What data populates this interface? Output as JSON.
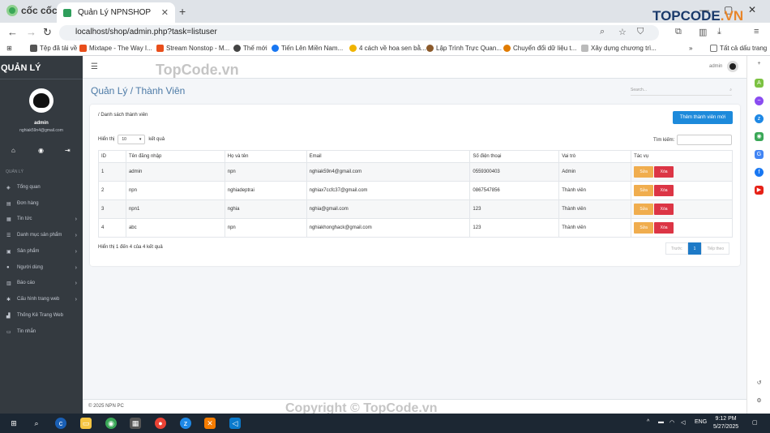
{
  "browser": {
    "brand": "cốc cốc",
    "tab_title": "Quản Lý NPNSHOP",
    "url": "localhost/shop/admin.php?task=listuser",
    "all_bookmarks": "Tất cả dấu trang",
    "bookmarks": [
      {
        "label": "Tệp đã tải về",
        "color": "#555"
      },
      {
        "label": "Mixtape - The Way I...",
        "color": "#e94e1b"
      },
      {
        "label": "Stream Nonstop - M...",
        "color": "#e94e1b"
      },
      {
        "label": "Thế mới",
        "color": "#444"
      },
      {
        "label": "Tiến Lên Miền Nam...",
        "color": "#1877f2"
      },
      {
        "label": "4 cách về hoa sen bằ...",
        "color": "#f0b400"
      },
      {
        "label": "Lập Trình Trực Quan...",
        "color": "#8b5a2b"
      },
      {
        "label": "Chuyển đổi dữ liệu t...",
        "color": "#e07b00"
      },
      {
        "label": "Xây dựng chương trì...",
        "color": "#999"
      }
    ]
  },
  "sidebar": {
    "title": "QUẢN LÝ",
    "username": "admin",
    "email": "nghiak59n4@gmail.com",
    "section": "QUẢN LÝ",
    "items": [
      {
        "label": "Tổng quan",
        "icon": "palette-icon",
        "arrow": false
      },
      {
        "label": "Đơn hàng",
        "icon": "receipt-icon",
        "arrow": false
      },
      {
        "label": "Tin tức",
        "icon": "news-icon",
        "arrow": true
      },
      {
        "label": "Danh mục sản phẩm",
        "icon": "list-icon",
        "arrow": true
      },
      {
        "label": "Sản phẩm",
        "icon": "box-icon",
        "arrow": true
      },
      {
        "label": "Người dùng",
        "icon": "user-icon",
        "arrow": true
      },
      {
        "label": "Báo cáo",
        "icon": "report-icon",
        "arrow": true
      },
      {
        "label": "Cấu hình trang web",
        "icon": "gears-icon",
        "arrow": true
      },
      {
        "label": "Thống Kê Trang Web",
        "icon": "chart-icon",
        "arrow": false
      },
      {
        "label": "Tin nhắn",
        "icon": "message-icon",
        "arrow": false
      }
    ]
  },
  "header": {
    "admin_label": "admin",
    "page_title": "Quản Lý / Thành Viên",
    "search_placeholder": "Search..."
  },
  "content": {
    "breadcrumb": "/ Danh sách thành viên",
    "add_button": "Thêm thành viên mới",
    "length_prefix": "Hiển thị",
    "length_value": "10",
    "length_suffix": "kết quả",
    "search_label": "Tìm kiếm:",
    "columns": [
      "ID",
      "Tên đăng nhập",
      "Họ và tên",
      "Email",
      "Số điện thoại",
      "Vai trò",
      "Tác vụ"
    ],
    "rows": [
      {
        "id": "1",
        "username": "admin",
        "fullname": "npn",
        "email": "nghiak59n4@gmail.com",
        "phone": "0559300403",
        "role": "Admin"
      },
      {
        "id": "2",
        "username": "npn",
        "fullname": "nghiadeptrai",
        "email": "nghiax7ccfc37@gmail.com",
        "phone": "0867547856",
        "role": "Thành viên"
      },
      {
        "id": "3",
        "username": "npn1",
        "fullname": "nghia",
        "email": "nghia@gmail.com",
        "phone": "123",
        "role": "Thành viên"
      },
      {
        "id": "4",
        "username": "abc",
        "fullname": "npn",
        "email": "nghiakhonghack@gmail.com",
        "phone": "123",
        "role": "Thành viên"
      }
    ],
    "edit_label": "Sửa",
    "delete_label": "Xóa",
    "info": "Hiển thị 1 đến 4 của 4 kết quả",
    "pager_prev": "Trước",
    "pager_page": "1",
    "pager_next": "Tiếp theo",
    "footer": "© 2025 NPN PC"
  },
  "watermark": {
    "top": "TopCode.vn",
    "bottom": "Copyright © TopCode.vn",
    "logo_main": "TOPCODE",
    "logo_tld": ".VN"
  },
  "taskbar": {
    "lang": "ENG",
    "time": "9:12 PM",
    "date": "5/27/2025"
  }
}
